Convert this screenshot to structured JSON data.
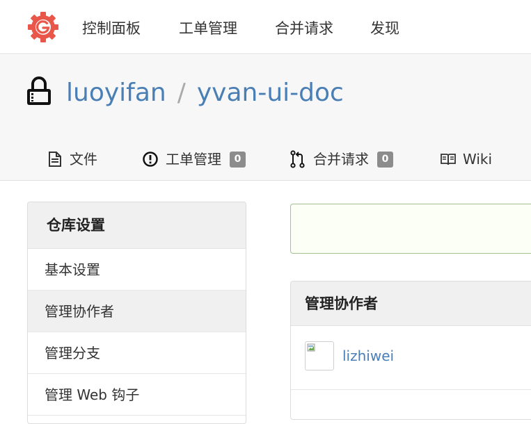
{
  "navbar": {
    "logo_icon": "gogs-logo-icon",
    "items": [
      "控制面板",
      "工单管理",
      "合并请求",
      "发现"
    ]
  },
  "repo": {
    "lock_icon": "lock-icon",
    "owner": "luoyifan",
    "separator": "/",
    "name": "yvan-ui-doc",
    "tabs": [
      {
        "label": "文件",
        "icon": "file-icon"
      },
      {
        "label": "工单管理",
        "icon": "issue-icon",
        "count": "0"
      },
      {
        "label": "合并请求",
        "icon": "pull-request-icon",
        "count": "0"
      },
      {
        "label": "Wiki",
        "icon": "book-icon"
      }
    ]
  },
  "settings_menu": {
    "header": "仓库设置",
    "items": [
      "基本设置",
      "管理协作者",
      "管理分支",
      "管理 Web 钩子"
    ],
    "active_index": 1
  },
  "collaborators": {
    "header": "管理协作者",
    "items": [
      {
        "name": "lizhiwei",
        "avatar": "broken-image-icon"
      }
    ]
  },
  "colors": {
    "link": "#4a7fb5",
    "badge": "#8c8c8c",
    "logo": "#e8574a",
    "alert_border": "#a3c293",
    "alert_bg": "#fcfff5"
  }
}
